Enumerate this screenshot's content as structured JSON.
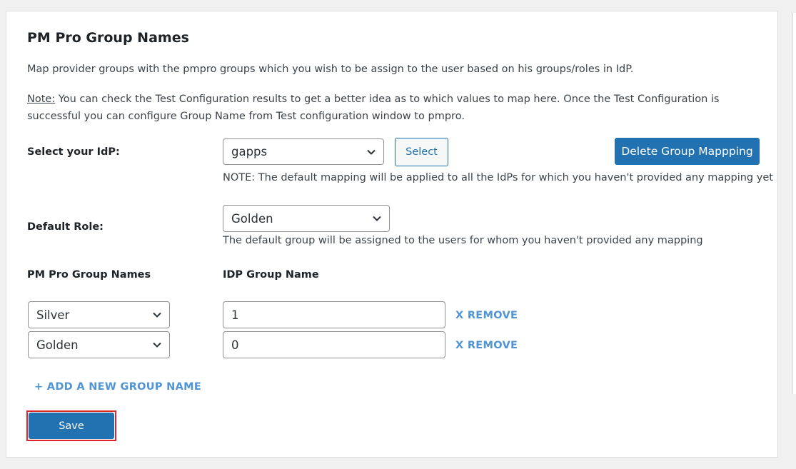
{
  "header": {
    "title": "PM Pro Group Names"
  },
  "intro": {
    "description": "Map provider groups with the pmpro groups which you wish to be assign to the user based on his groups/roles in IdP.",
    "note_label": "Note:",
    "note_text": " You can check the Test Configuration results to get a better idea as to which values to map here. Once the Test Configuration is successful you can configure Group Name from Test configuration window to pmpro."
  },
  "idp": {
    "label": "Select your IdP:",
    "selected": "gapps",
    "select_button": "Select",
    "delete_button": "Delete Group Mappping",
    "note": "NOTE: The default mapping will be applied to all the IdPs for which you haven't provided any mapping yet"
  },
  "default_role": {
    "label": "Default Role:",
    "selected": "Golden",
    "help": "The default group will be assigned to the users for whom you haven't provided any mapping"
  },
  "mapping": {
    "col_group": "PM Pro Group Names",
    "col_idp": "IDP Group Name",
    "rows": [
      {
        "group": "Silver",
        "idp_value": "1",
        "remove": "X REMOVE"
      },
      {
        "group": "Golden",
        "idp_value": "0",
        "remove": "X REMOVE"
      }
    ],
    "add_link": "+ ADD A NEW GROUP NAME"
  },
  "actions": {
    "save": "Save"
  },
  "colors": {
    "primary": "#2271b1",
    "link": "#4f94d4",
    "highlight": "#e0242b"
  },
  "icons": {
    "dropdown": "chevron-down-icon"
  }
}
